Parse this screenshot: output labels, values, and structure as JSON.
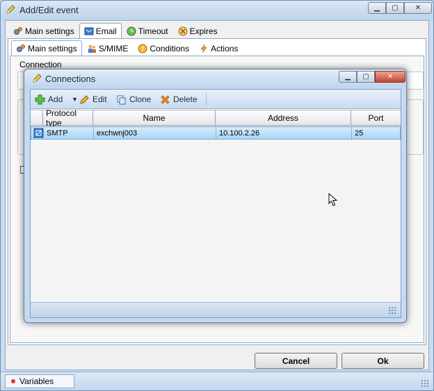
{
  "window": {
    "title": "Add/Edit event",
    "tabs": [
      "Main settings",
      "Email",
      "Timeout",
      "Expires"
    ],
    "active_tab": "Email",
    "subtabs": [
      "Main settings",
      "S/MIME",
      "Conditions",
      "Actions"
    ],
    "active_subtab": "Main settings",
    "connection_group": "Connection",
    "cancel_label": "Cancel",
    "ok_label": "Ok",
    "status_tab": "Variables"
  },
  "dialog": {
    "title": "Connections",
    "toolbar": {
      "add": "Add",
      "edit": "Edit",
      "clone": "Clone",
      "delete": "Delete"
    },
    "columns": [
      "Protocol type",
      "Name",
      "Address",
      "Port"
    ],
    "rows": [
      {
        "protocol": "SMTP",
        "name": "exchwnj003",
        "address": "10.100.2.26",
        "port": "25"
      }
    ]
  },
  "colors": {
    "accent": "#c7452f",
    "selection": "#a9d4f5"
  }
}
